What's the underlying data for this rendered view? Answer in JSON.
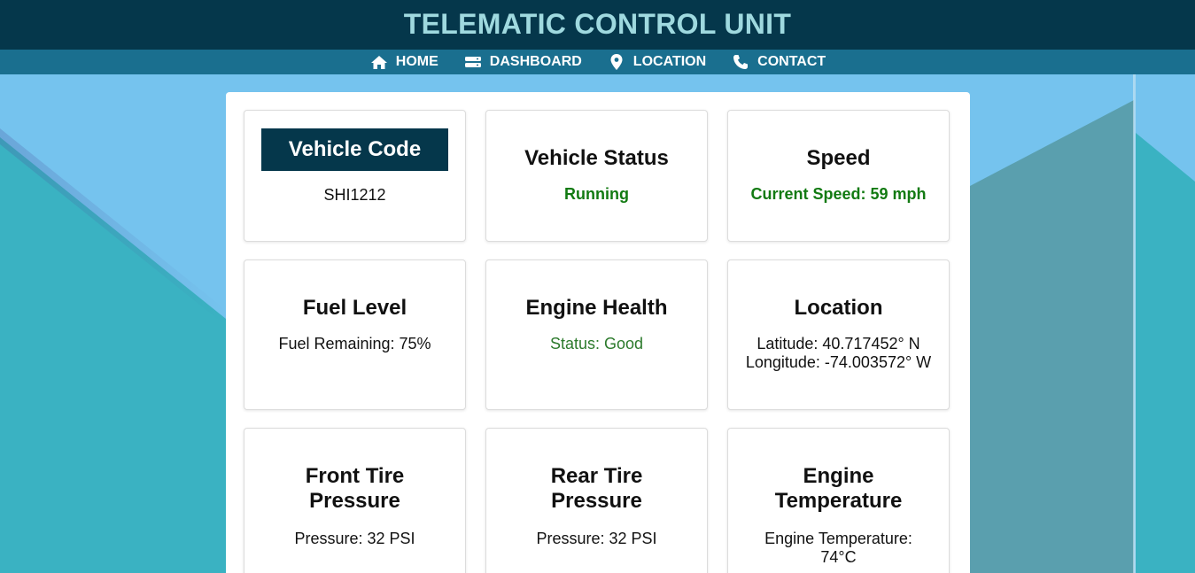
{
  "header": {
    "title": "TELEMATIC CONTROL UNIT"
  },
  "nav": {
    "items": [
      {
        "label": "HOME",
        "icon": "home-icon"
      },
      {
        "label": "DASHBOARD",
        "icon": "dashboard-icon"
      },
      {
        "label": "LOCATION",
        "icon": "location-pin-icon"
      },
      {
        "label": "CONTACT",
        "icon": "phone-icon"
      }
    ]
  },
  "cards": {
    "vehicle_code": {
      "title": "Vehicle Code",
      "value": "SHI1212"
    },
    "vehicle_status": {
      "title": "Vehicle Status",
      "value": "Running"
    },
    "speed": {
      "title": "Speed",
      "value": "Current Speed: 59 mph"
    },
    "fuel_level": {
      "title": "Fuel Level",
      "value": "Fuel Remaining: 75%"
    },
    "engine_health": {
      "title": "Engine Health",
      "value": "Status: Good"
    },
    "location": {
      "title": "Location",
      "latitude": "Latitude: 40.717452° N",
      "longitude": "Longitude: -74.003572° W"
    },
    "front_tire": {
      "title_line1": "Front Tire",
      "title_line2": "Pressure",
      "value": "Pressure: 32 PSI"
    },
    "rear_tire": {
      "title_line1": "Rear Tire",
      "title_line2": "Pressure",
      "value": "Pressure: 32 PSI"
    },
    "engine_temp": {
      "title_line1": "Engine",
      "title_line2": "Temperature",
      "value_line1": "Engine Temperature:",
      "value_line2": "74°C"
    }
  },
  "colors": {
    "header_bg": "#05374b",
    "header_text": "#9fd9df",
    "nav_bg": "#1a6f8f",
    "sky": "#75c3ee",
    "teal": "#3ab2c2",
    "status_green": "#127a12"
  }
}
